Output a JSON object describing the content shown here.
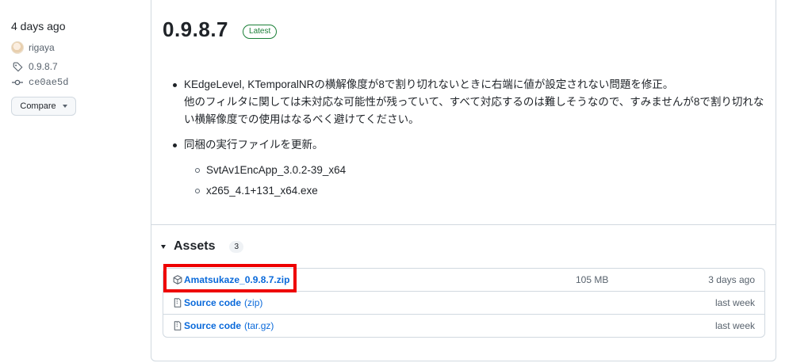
{
  "sidebar": {
    "date": "4 days ago",
    "author": "rigaya",
    "tag": "0.9.8.7",
    "commit": "ce0ae5d",
    "compare_label": "Compare"
  },
  "release": {
    "title": "0.9.8.7",
    "badge": "Latest",
    "notes": {
      "item1_line1": "KEdgeLevel, KTemporalNRの横解像度が8で割り切れないときに右端に値が設定されない問題を修正。",
      "item1_line2": "他のフィルタに関しては未対応な可能性が残っていて、すべて対応するのは難しそうなので、すみませんが8で割り切れない横解像度での使用はなるべく避けてください。",
      "item2": "同梱の実行ファイルを更新。",
      "sub_items": [
        "SvtAv1EncApp_3.0.2-39_x64",
        "x265_4.1+131_x64.exe"
      ]
    }
  },
  "assets": {
    "title": "Assets",
    "count": "3",
    "items": [
      {
        "name": "Amatsukaze_0.9.8.7.zip",
        "suffix": "",
        "size": "105 MB",
        "date": "3 days ago",
        "icon": "package-icon"
      },
      {
        "name": "Source code",
        "suffix": "(zip)",
        "size": "",
        "date": "last week",
        "icon": "file-zip-icon"
      },
      {
        "name": "Source code",
        "suffix": "(tar.gz)",
        "size": "",
        "date": "last week",
        "icon": "file-zip-icon"
      }
    ]
  },
  "colors": {
    "link": "#0969da",
    "latest_badge": "#1a7f37",
    "highlight": "#ee0000"
  }
}
